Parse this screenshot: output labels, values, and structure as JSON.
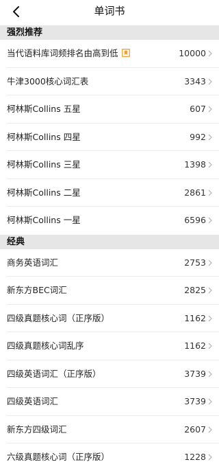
{
  "header": {
    "title": "单词书"
  },
  "sections": [
    {
      "title": "强烈推荐",
      "items": [
        {
          "name": "当代语料库词频排名由高到低",
          "count": "10000",
          "badge": "bookmark-icon"
        },
        {
          "name": "牛津3000核心词汇表",
          "count": "3343"
        },
        {
          "name": "柯林斯Collins 五星",
          "count": "607"
        },
        {
          "name": "柯林斯Collins 四星",
          "count": "992"
        },
        {
          "name": "柯林斯Collins 三星",
          "count": "1398"
        },
        {
          "name": "柯林斯Collins 二星",
          "count": "2861"
        },
        {
          "name": "柯林斯Collins 一星",
          "count": "6596"
        }
      ]
    },
    {
      "title": "经典",
      "items": [
        {
          "name": "商务英语词汇",
          "count": "2753"
        },
        {
          "name": "新东方BEC词汇",
          "count": "2825"
        },
        {
          "name": "四级真题核心词（正序版）",
          "count": "1162"
        },
        {
          "name": "四级真题核心词乱序",
          "count": "1162"
        },
        {
          "name": "四级英语词汇（正序版）",
          "count": "3739"
        },
        {
          "name": "四级英语词汇",
          "count": "3739"
        },
        {
          "name": "新东方四级词汇",
          "count": "2607"
        },
        {
          "name": "六级真题核心词（正序版）",
          "count": "1228"
        }
      ]
    }
  ],
  "colors": {
    "section_bg": "#e6e6e6",
    "badge": "#f0a030",
    "chevron": "#bbbbbb"
  }
}
